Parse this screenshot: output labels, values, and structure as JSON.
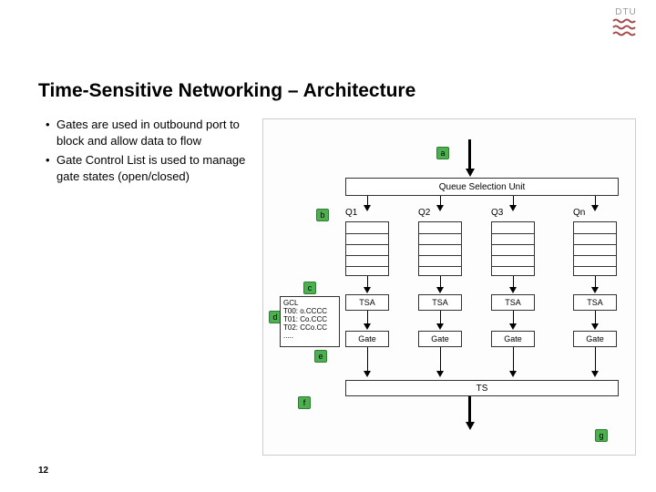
{
  "logo": {
    "text": "DTU"
  },
  "title": "Time-Sensitive Networking – Architecture",
  "bullets": [
    "Gates are used in outbound port to block and allow data to flow",
    "Gate Control List is used to manage gate states (open/closed)"
  ],
  "page_number": "12",
  "diagram": {
    "markers": {
      "a": "a",
      "b": "b",
      "c": "c",
      "d": "d",
      "e": "e",
      "f": "f",
      "g": "g"
    },
    "qsu": "Queue Selection Unit",
    "queues": [
      "Q1",
      "Q2",
      "Q3",
      "Qn"
    ],
    "tsa": "TSA",
    "gate": "Gate",
    "ts": "TS",
    "gcl": {
      "title": "GCL",
      "rows": [
        "T00: o.CCCC",
        "T01: Co.CCC",
        "T02: CCo.CC",
        "....."
      ]
    }
  }
}
